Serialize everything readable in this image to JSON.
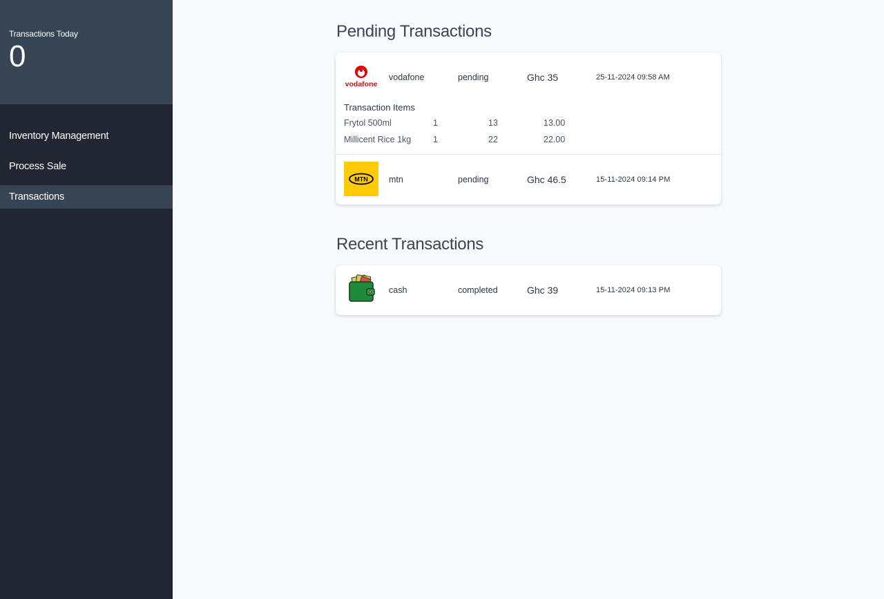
{
  "sidebar": {
    "stats_label": "Transactions Today",
    "stats_value": "0",
    "items": [
      {
        "label": "Inventory Management"
      },
      {
        "label": "Process Sale"
      },
      {
        "label": "Transactions"
      }
    ]
  },
  "pending": {
    "title": "Pending Transactions",
    "transactions": [
      {
        "provider": "vodafone",
        "status": "pending",
        "amount": "Ghc 35",
        "date": "25-11-2024 09:58 AM",
        "logo_text": "vodafone",
        "items_title": "Transaction Items",
        "items": [
          {
            "name": "Frytol 500ml",
            "qty": "1",
            "price": "13",
            "total": "13.00"
          },
          {
            "name": "Millicent Rice 1kg",
            "qty": "1",
            "price": "22",
            "total": "22.00"
          }
        ]
      },
      {
        "provider": "mtn",
        "status": "pending",
        "amount": "Ghc 46.5",
        "date": "15-11-2024 09:14 PM",
        "logo_text": "MTN"
      }
    ]
  },
  "recent": {
    "title": "Recent Transactions",
    "transactions": [
      {
        "provider": "cash",
        "status": "completed",
        "amount": "Ghc 39",
        "date": "15-11-2024 09:13 PM"
      }
    ]
  },
  "colors": {
    "sidebar_bg": "#212631",
    "sidebar_active": "#364454",
    "page_bg": "#f8f9fb",
    "vodafone_red": "#e60000",
    "mtn_yellow": "#ffcb05"
  },
  "icons": {
    "vodafone": "vodafone-logo-icon",
    "mtn": "mtn-logo-icon",
    "cash": "wallet-icon"
  }
}
